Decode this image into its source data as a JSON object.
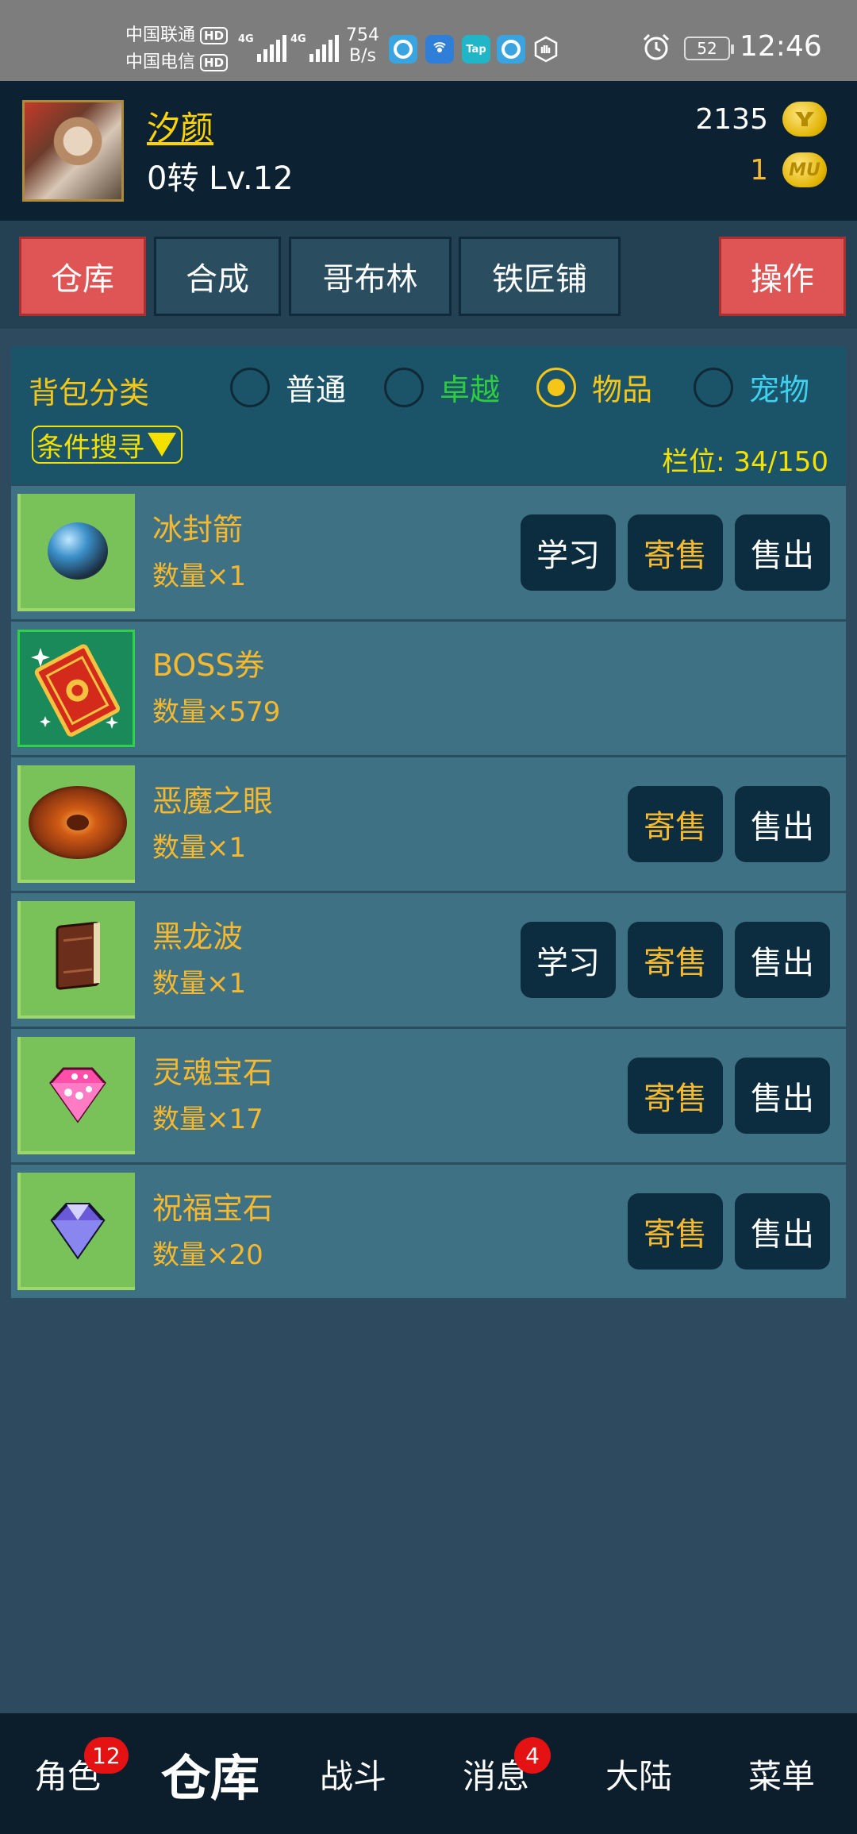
{
  "status_bar": {
    "carrier1": "中国联通",
    "carrier2": "中国电信",
    "hd": "HD",
    "net_type": "4G",
    "speed_value": "754",
    "speed_unit": "B/s",
    "tap_label": "Tap",
    "battery": "52",
    "time": "12:46"
  },
  "player": {
    "name": "汐颜",
    "level": "0转 Lv.12",
    "gold": "2135",
    "mu": "1",
    "mu_coin_label": "MU"
  },
  "top_tabs": {
    "warehouse": "仓库",
    "synthesis": "合成",
    "goblin": "哥布林",
    "blacksmith": "铁匠铺",
    "operate": "操作"
  },
  "bag": {
    "title": "背包分类",
    "options": [
      "普通",
      "卓越",
      "物品",
      "宠物"
    ],
    "selected": "物品",
    "filter_label": "条件搜寻",
    "slots": "栏位: 34/150",
    "colors": {
      "normal": "#ffffff",
      "excellent": "#2ecc40",
      "item": "#f5c518",
      "pet": "#3fd0f0"
    }
  },
  "actions": {
    "learn": "学习",
    "consign": "寄售",
    "sell": "售出"
  },
  "items": [
    {
      "name": "冰封箭",
      "qty": "数量×1",
      "icon": "blue-orb-icon"
    },
    {
      "name": "BOSS券",
      "qty": "数量×579",
      "icon": "boss-ticket-icon"
    },
    {
      "name": "恶魔之眼",
      "qty": "数量×1",
      "icon": "demon-eye-icon"
    },
    {
      "name": "黑龙波",
      "qty": "数量×1",
      "icon": "skill-book-icon"
    },
    {
      "name": "灵魂宝石",
      "qty": "数量×17",
      "icon": "pink-gem-icon"
    },
    {
      "name": "祝福宝石",
      "qty": "数量×20",
      "icon": "purple-gem-icon"
    }
  ],
  "bottom_nav": {
    "character": "角色",
    "character_badge": "12",
    "warehouse": "仓库",
    "battle": "战斗",
    "messages": "消息",
    "messages_badge": "4",
    "continent": "大陆",
    "menu": "菜单"
  }
}
